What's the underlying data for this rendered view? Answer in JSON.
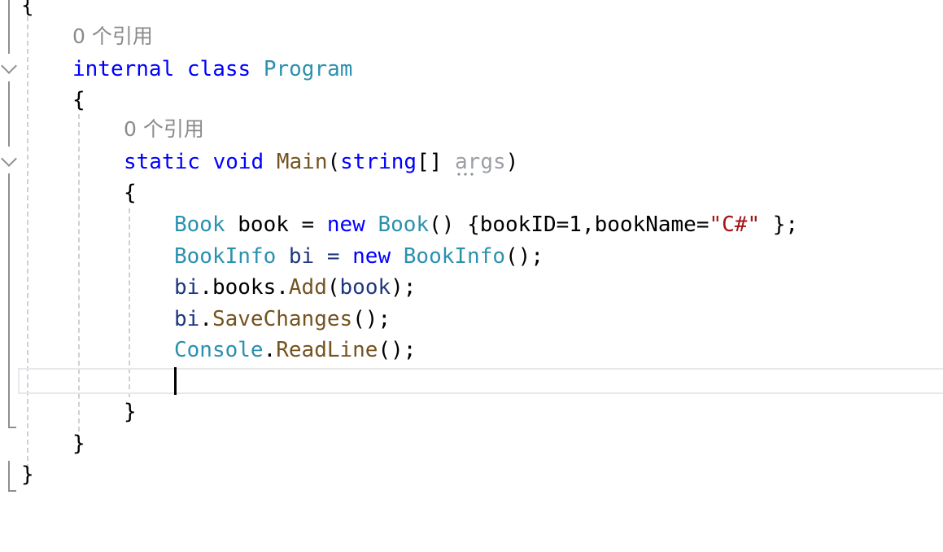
{
  "editor": {
    "lines": {
      "open_brace_outer": "{",
      "class_lens": "0 个引用",
      "class_decl": {
        "modifier": "internal",
        "keyword": "class",
        "name": "Program"
      },
      "class_open": "{",
      "method_lens": "0 个引用",
      "method_decl": {
        "modifier": "static",
        "return_type": "void",
        "name": "Main",
        "open_paren": "(",
        "param_type": "string",
        "brackets": "[]",
        "space": " ",
        "param_name": "args",
        "close_paren": ")"
      },
      "method_open": "{",
      "stmt1": {
        "type": "Book",
        "var": " book = ",
        "new": "new",
        "ctor": " Book",
        "rest_a": "() {bookID=1,bookName=",
        "string": "\"C#\"",
        "rest_b": " };"
      },
      "stmt2": {
        "type": "BookInfo",
        "var": " bi = ",
        "new": "new",
        "ctor": " BookInfo",
        "rest": "();"
      },
      "stmt3": {
        "obj": "bi",
        "dot1": ".",
        "prop": "books",
        "dot2": ".",
        "method": "Add",
        "open": "(",
        "arg": "book",
        "close": ");"
      },
      "stmt4": {
        "obj": "bi",
        "dot": ".",
        "method": "SaveChanges",
        "rest": "();"
      },
      "stmt5": {
        "type": "Console",
        "dot": ".",
        "method": "ReadLine",
        "rest": "();"
      },
      "method_close": "}",
      "class_close": "}",
      "namespace_close": "}"
    }
  },
  "colors": {
    "keyword": "#0000ff",
    "type": "#2b91af",
    "method": "#74531f",
    "string": "#a31515",
    "identifier": "#1f377f",
    "codelens": "#8a8a8a"
  }
}
